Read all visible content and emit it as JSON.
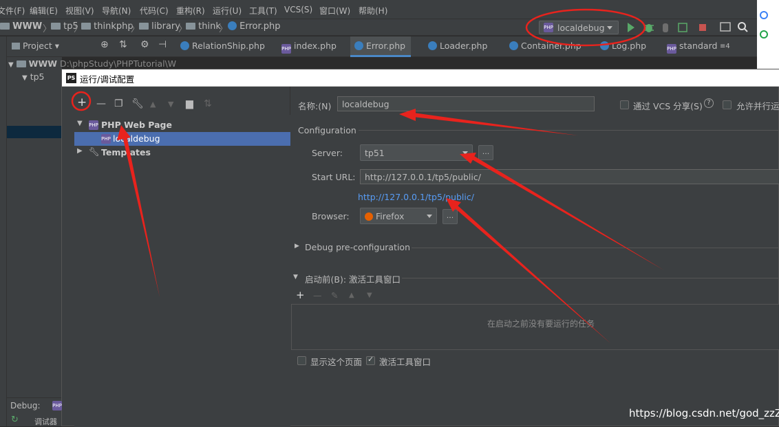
{
  "menu": {
    "items": [
      "文件(F)",
      "编辑(E)",
      "视图(V)",
      "导航(N)",
      "代码(C)",
      "重构(R)",
      "运行(U)",
      "工具(T)",
      "VCS(S)",
      "窗口(W)",
      "帮助(H)"
    ]
  },
  "breadcrumb": {
    "items": [
      "WWW",
      "tp5",
      "thinkphp",
      "library",
      "think",
      "Error.php"
    ]
  },
  "toolbar": {
    "run_config": "localdebug"
  },
  "tabs": {
    "project_label": "Project",
    "files": [
      "RelationShip.php",
      "index.php",
      "Error.php",
      "Loader.php",
      "Container.php",
      "Log.php",
      "standard"
    ],
    "overflow": "≡4"
  },
  "project": {
    "root": "WWW",
    "root_path": "D:\\phpStudy\\PHPTutorial\\W",
    "child": "tp5"
  },
  "dialog": {
    "title": "运行/调试配置",
    "tree": {
      "group": "PHP Web Page",
      "selected": "localdebug",
      "templates": "Templates"
    },
    "name_label": "名称:(N)",
    "name_value": "localdebug",
    "share_vcs": "通过 VCS 分享(S)",
    "allow_parallel": "允许并行运行",
    "section_configuration": "Configuration",
    "server_label": "Server:",
    "server_value": "tp51",
    "start_url_label": "Start URL:",
    "start_url_value": "http://127.0.0.1/tp5/public/",
    "url_link": "http://127.0.0.1/tp5/public/",
    "browser_label": "Browser:",
    "browser_value": "Firefox",
    "debug_preconfig": "Debug pre-configuration",
    "before_launch": "启动前(B): 激活工具窗口",
    "no_tasks": "在启动之前没有要运行的任务",
    "show_page": "显示这个页面",
    "activate_tool_window": "激活工具窗口",
    "browse_button": "..."
  },
  "debug": {
    "label": "Debug:",
    "sublabel": "调试器"
  },
  "watermark": "https://blog.csdn.net/god_zzZ",
  "colors": {
    "accent": "#4b6eaf",
    "annotation_red": "#e8231d",
    "link": "#589df6"
  }
}
